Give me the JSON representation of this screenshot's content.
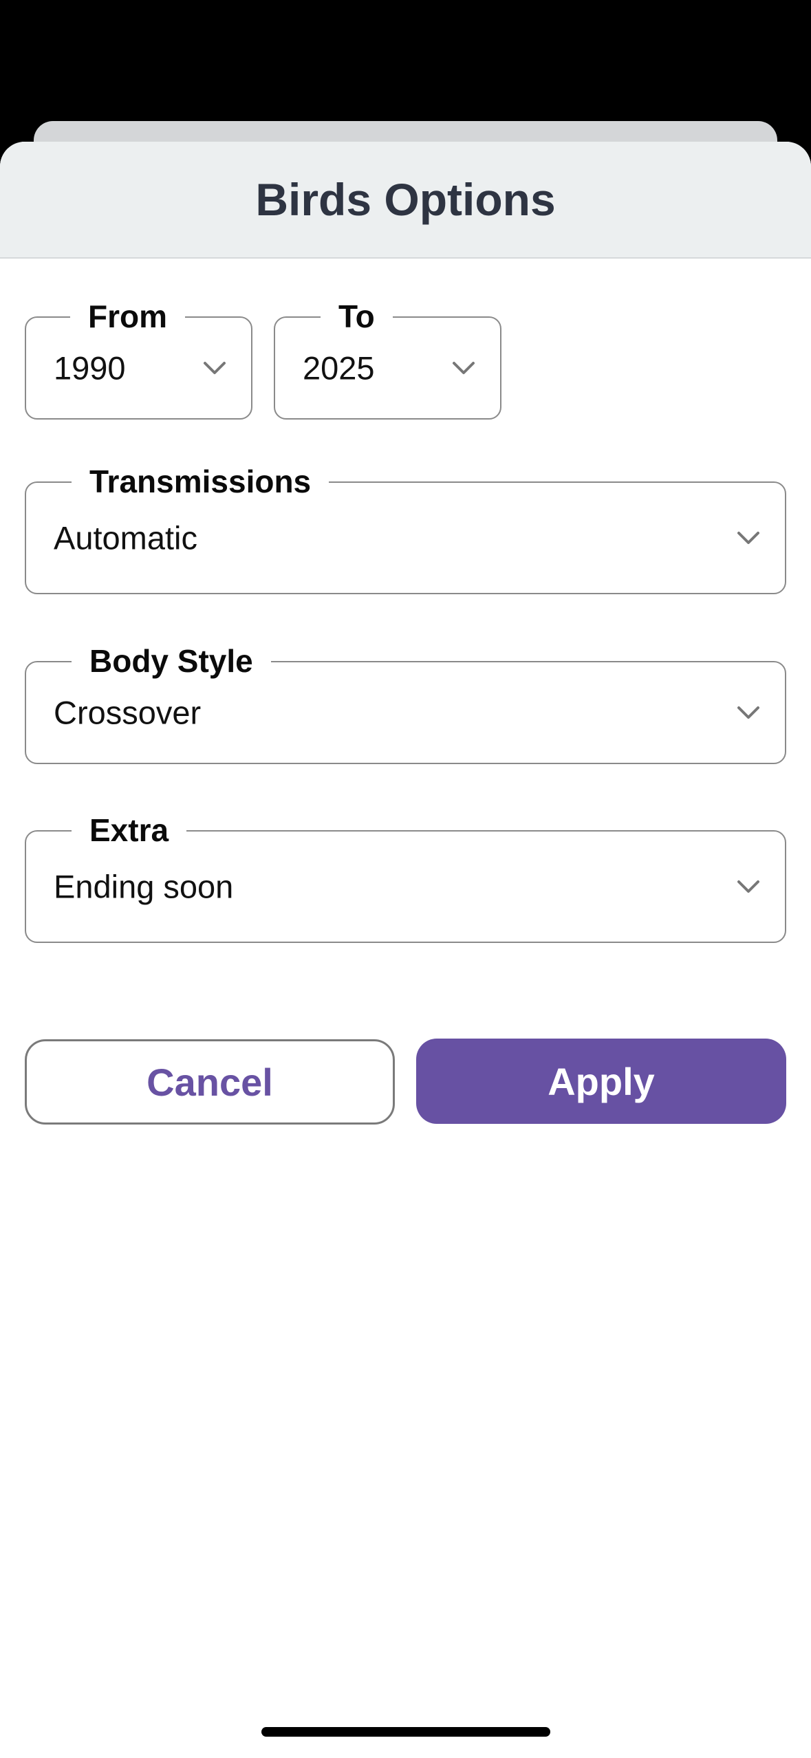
{
  "sheet": {
    "title": "Birds Options"
  },
  "filters": {
    "from": {
      "label": "From",
      "value": "1990"
    },
    "to": {
      "label": "To",
      "value": "2025"
    },
    "transmissions": {
      "label": "Transmissions",
      "value": "Automatic"
    },
    "body_style": {
      "label": "Body Style",
      "value": "Crossover"
    },
    "extra": {
      "label": "Extra",
      "value": "Ending soon"
    }
  },
  "actions": {
    "cancel_label": "Cancel",
    "apply_label": "Apply"
  },
  "colors": {
    "accent": "#6751a3",
    "header_bg": "#eceff0",
    "title_text": "#2e3442"
  },
  "icons": {
    "select_indicator": "chevron-down-icon"
  }
}
